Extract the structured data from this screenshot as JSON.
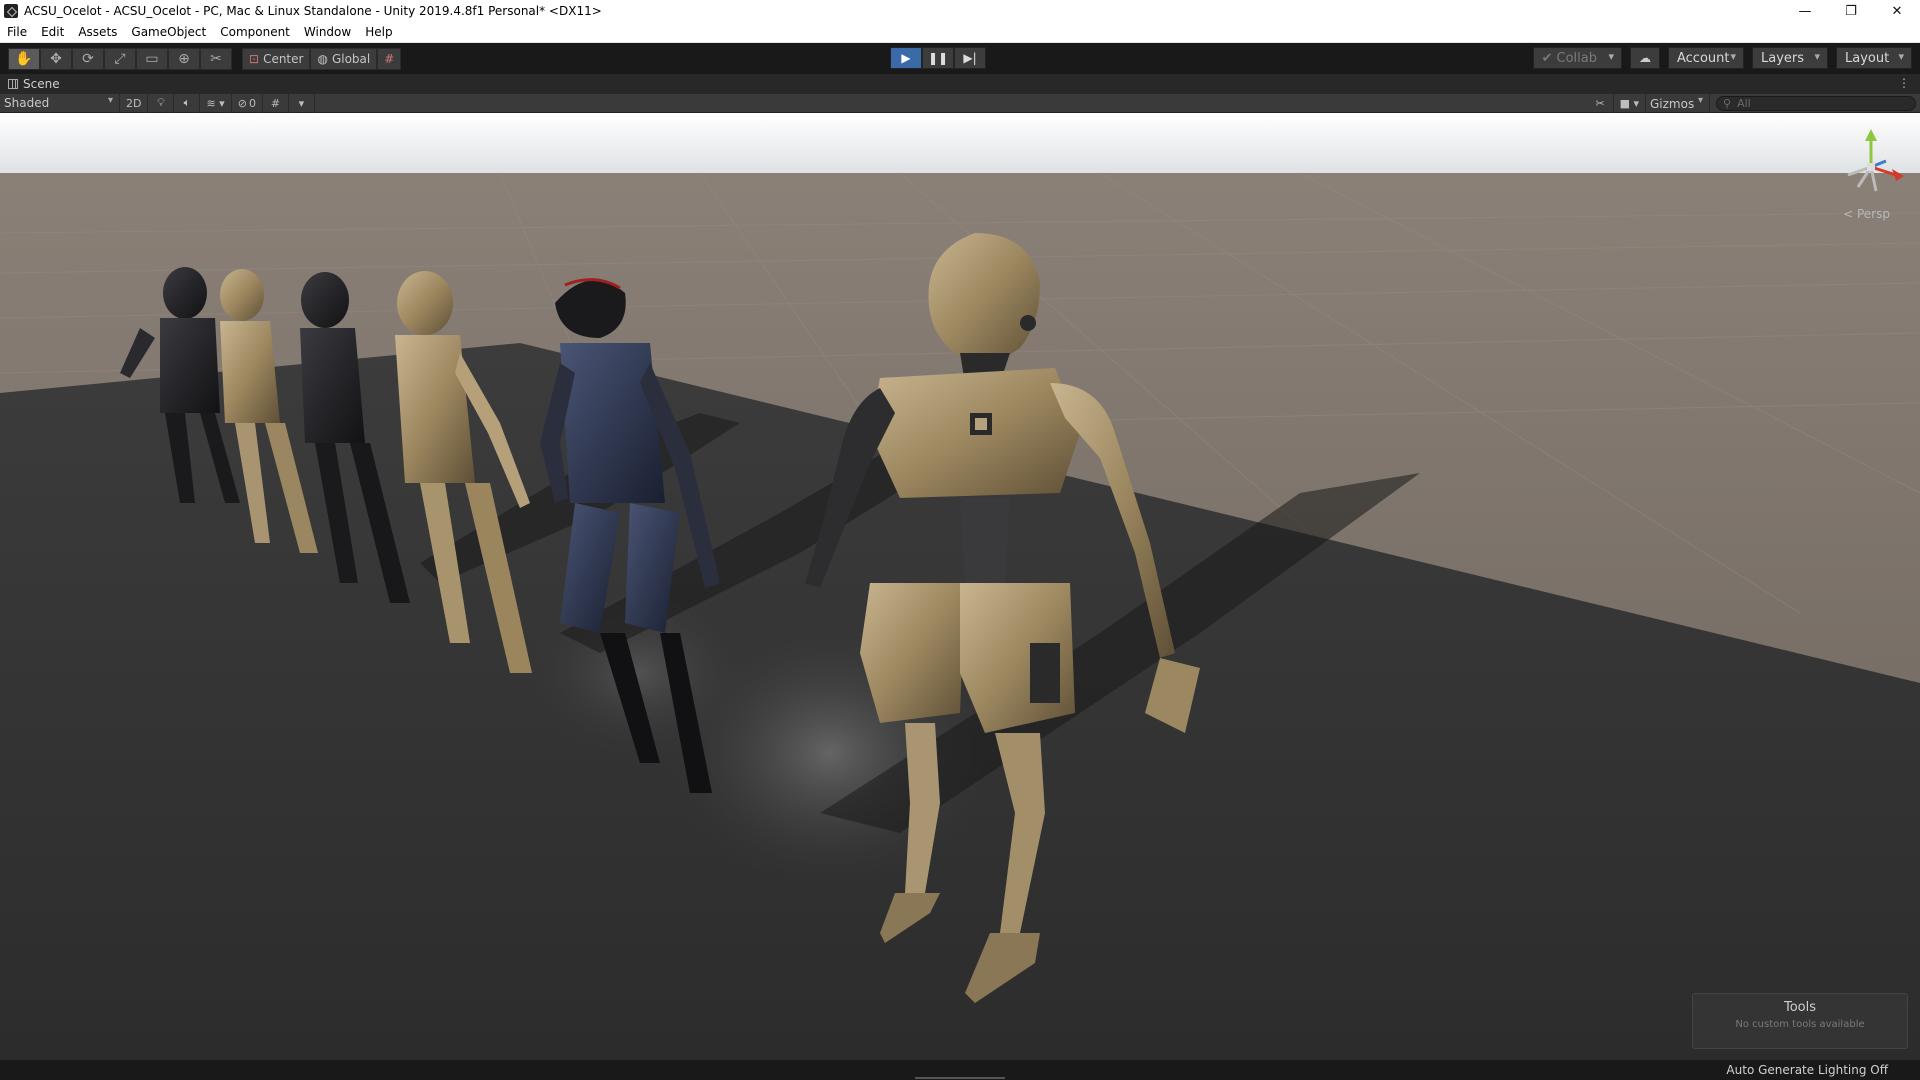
{
  "window": {
    "title": "ACSU_Ocelot - ACSU_Ocelot - PC, Mac & Linux Standalone - Unity 2019.4.8f1 Personal* <DX11>",
    "controls": {
      "minimize": "—",
      "restore": "❐",
      "close": "✕"
    }
  },
  "menu": [
    "File",
    "Edit",
    "Assets",
    "GameObject",
    "Component",
    "Window",
    "Help"
  ],
  "toolbar": {
    "tools": [
      {
        "name": "hand-tool",
        "glyph": "✋"
      },
      {
        "name": "move-tool",
        "glyph": "✥"
      },
      {
        "name": "rotate-tool",
        "glyph": "⟳"
      },
      {
        "name": "scale-tool",
        "glyph": "⤢"
      },
      {
        "name": "rect-tool",
        "glyph": "▭"
      },
      {
        "name": "transform-tool",
        "glyph": "⊕"
      },
      {
        "name": "custom-tool",
        "glyph": "✂"
      }
    ],
    "pivot_label": "Center",
    "rotation_label": "Global",
    "play_controls": [
      "▶",
      "❚❚",
      "▶|"
    ],
    "collab_label": "Collab",
    "account_label": "Account",
    "layers_label": "Layers",
    "layout_label": "Layout"
  },
  "scene": {
    "tab_label": "Scene",
    "shading_mode": "Shaded",
    "mode_2d": "2D",
    "hidden_count": "0",
    "gizmos_label": "Gizmos",
    "search_placeholder": "All",
    "projection_label": "< Persp",
    "tools_overlay_title": "Tools",
    "tools_overlay_subtitle": "No custom tools available"
  },
  "status": {
    "lighting": "Auto Generate Lighting Off"
  },
  "colors": {
    "play_active": "#3b6aa8",
    "robot_tan": "#a08a64",
    "robot_dark": "#1e1e22",
    "robot_navy": "#2a3146",
    "ground": "#333333",
    "horizon": "#6f6960"
  }
}
